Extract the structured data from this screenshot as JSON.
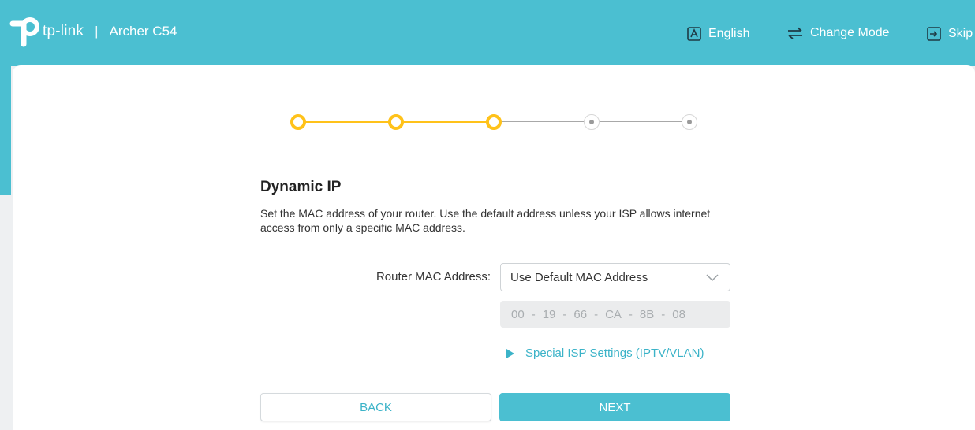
{
  "header": {
    "brand_name": "tp-link",
    "separator": "|",
    "model": "Archer C54",
    "language_label": "English",
    "change_mode_label": "Change Mode",
    "skip_label": "Skip"
  },
  "stepper": {
    "total_steps": 5,
    "completed_steps": 3,
    "active_color": "#ffc21a",
    "inactive_color": "#cccccc"
  },
  "page": {
    "title": "Dynamic IP",
    "description": "Set the MAC address of your router. Use the default address unless your ISP allows internet access from only a specific MAC address."
  },
  "mac": {
    "label": "Router MAC Address:",
    "selected_option": "Use Default MAC Address",
    "address_parts": [
      "00",
      "19",
      "66",
      "CA",
      "8B",
      "08"
    ],
    "separator": "-"
  },
  "special_isp": {
    "label": "Special ISP Settings (IPTV/VLAN)"
  },
  "buttons": {
    "back": "BACK",
    "next": "NEXT"
  },
  "colors": {
    "brand": "#4bbfd1",
    "link": "#3bb3c8",
    "step_done": "#ffc21a"
  }
}
